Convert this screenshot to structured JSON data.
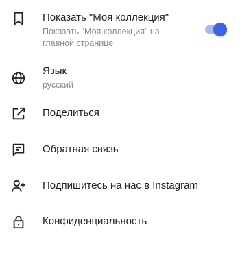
{
  "items": [
    {
      "title": "Показать \"Моя коллекция\"",
      "subtitle": "Показать \"Моя коллекция\" на главной странице",
      "icon": "bookmark-icon",
      "toggle_on": true
    },
    {
      "title": "Язык",
      "subtitle": "русский",
      "icon": "globe-icon"
    },
    {
      "title": "Поделиться",
      "icon": "share-icon"
    },
    {
      "title": "Обратная связь",
      "icon": "feedback-icon"
    },
    {
      "title": "Подпишитесь на нас в Instagram",
      "icon": "add-person-icon"
    },
    {
      "title": "Конфиденциальность",
      "icon": "lock-icon"
    }
  ],
  "colors": {
    "accent": "#3d64e3",
    "accent_track": "#a8b9f0",
    "text": "#202124",
    "subtext": "#8a8a8a"
  }
}
